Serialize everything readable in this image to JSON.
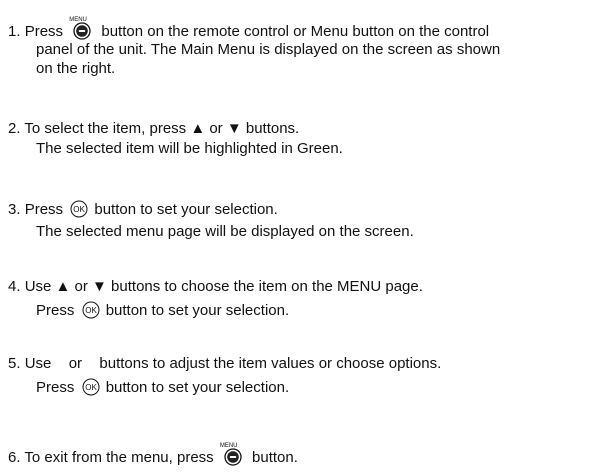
{
  "menu_button_caption": "MENU",
  "ok_icon_text": "OK",
  "steps": [
    {
      "num": "1.",
      "parts": [
        "Press",
        "button on the remote control or Menu button on the control"
      ],
      "cont": [
        "panel of the unit. The Main Menu is displayed on the screen as shown",
        "on the right."
      ]
    },
    {
      "num": "2.",
      "line1": "To select the item, press ▲ or ▼ buttons.",
      "line2": "The selected item will be highlighted in Green."
    },
    {
      "num": "3.",
      "parts": [
        "Press",
        "button to set your selection."
      ],
      "line2": "The selected menu page will be displayed on the screen."
    },
    {
      "num": "4.",
      "line1": "Use ▲ or ▼ buttons to choose the item on the MENU page.",
      "parts2": [
        "Press",
        "button to set your selection."
      ]
    },
    {
      "num": "5.",
      "line1_parts": [
        "Use",
        "or",
        "buttons to adjust the item values or choose options."
      ],
      "parts2": [
        "Press",
        "button to set your selection."
      ]
    },
    {
      "num": "6.",
      "parts": [
        "To exit from the menu, press",
        "button."
      ]
    }
  ]
}
